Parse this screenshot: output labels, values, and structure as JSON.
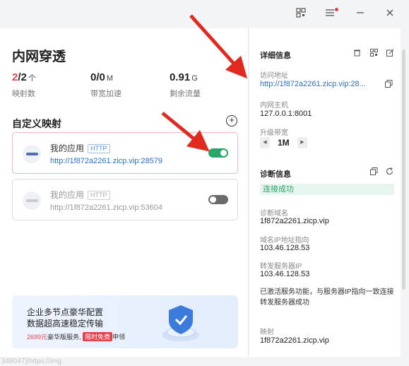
{
  "titlebar": {
    "icons": [
      "qr-code-icon",
      "menu-icon",
      "minimize-icon",
      "close-icon"
    ],
    "notification_dot_color": "#e5414b"
  },
  "left": {
    "title": "内网穿透",
    "stats": [
      {
        "value_main": "2",
        "value_rest": "/2",
        "unit": "个",
        "label": "映射数"
      },
      {
        "value_main": "",
        "value_rest": "0/0",
        "unit": "M",
        "label": "带宽加速"
      },
      {
        "value_main": "",
        "value_rest": "0.91",
        "unit": "G",
        "label": "剩余流量"
      }
    ],
    "mappings_title": "自定义映射",
    "add_icon": "+",
    "mappings": [
      {
        "name": "我的应用",
        "protocol": "HTTP",
        "url": "http://1f872a2261.zicp.vip:28579",
        "enabled": true
      },
      {
        "name": "我的应用",
        "protocol": "HTTP",
        "url": "http://1f872a2261.zicp.vip:53604",
        "enabled": false
      }
    ],
    "banner": {
      "line1": "企业多节点豪华配置",
      "line2": "数据超高速稳定传输",
      "price": "2699元",
      "middle": "豪华版服务,",
      "tag": "限时免费",
      "tail": "申领"
    }
  },
  "right": {
    "detail_title": "详细信息",
    "access_label": "访问地址",
    "access_value": "http://1f872a2261.zicp.vip:28...",
    "host_label": "内网主机",
    "host_value": "127.0.0.1:8001",
    "bandwidth_label": "升级带宽",
    "bandwidth_value": "1M",
    "diag_title": "诊断信息",
    "diag_status": "连接成功",
    "diag_domain_label": "诊断域名",
    "diag_domain_value": "1f872a2261.zicp.vip",
    "ip_label": "域名IP地址指向",
    "ip_value": "103.46.128.53",
    "fwd_label": "转发服务器IP",
    "fwd_value": "103.46.128.53",
    "diag_message": "已激活服务功能，与服务器IP指向一致连接转发服务器成功",
    "map_label": "映射",
    "map_value": "1f872a2261.zicp.vip"
  },
  "footer": {
    "text": "348047]/https://img"
  },
  "colors": {
    "accent": "#2b72c9",
    "success": "#2aa56a",
    "danger": "#e5414b",
    "annotation_arrow": "#e02a1f"
  }
}
